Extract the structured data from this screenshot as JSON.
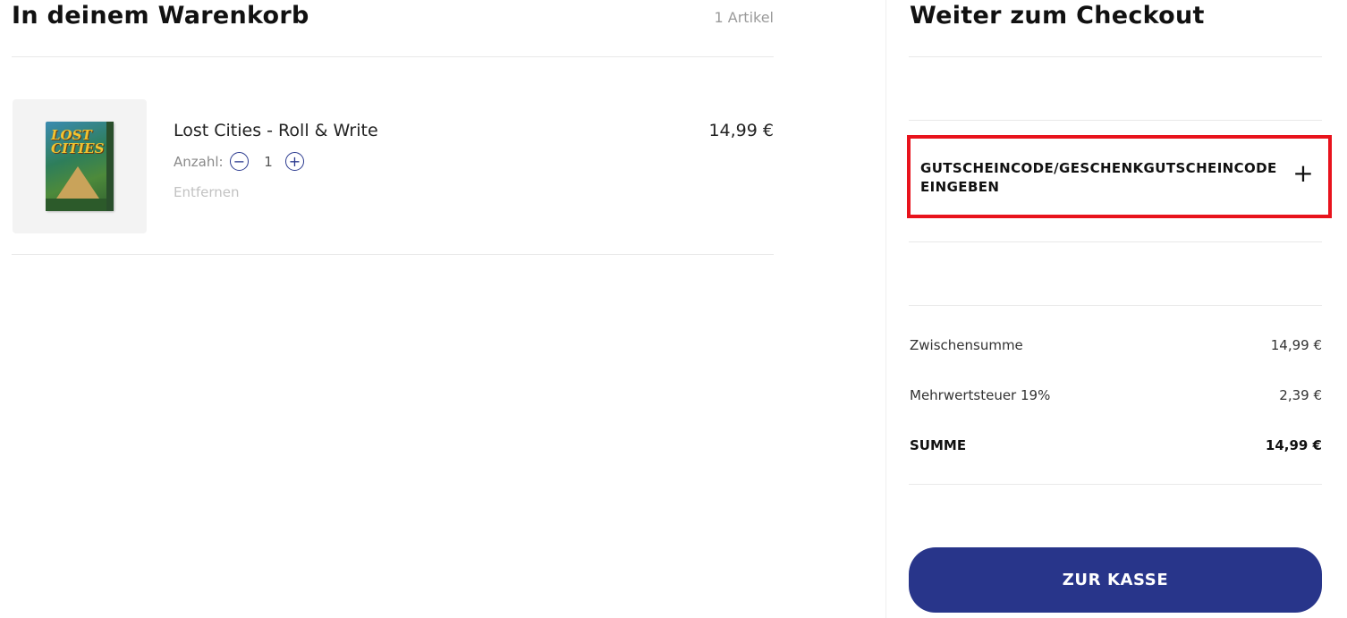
{
  "cart": {
    "title": "In deinem Warenkorb",
    "count": "1 Artikel",
    "items": [
      {
        "name": "Lost Cities - Roll & Write",
        "price": "14,99 €",
        "quantity_label": "Anzahl:",
        "quantity": "1",
        "remove_label": "Entfernen",
        "thumbnail_icon": "game-box-image"
      }
    ]
  },
  "checkout": {
    "title": "Weiter zum Checkout",
    "coupon_label": "GUTSCHEINCODE/GESCHENKGUTSCHEINCODE EINGEBEN",
    "coupon_expand_icon": "plus-icon",
    "summary": {
      "subtotal_label": "Zwischensumme",
      "subtotal_value": "14,99 €",
      "tax_label": "Mehrwertsteuer 19%",
      "tax_value": "2,39 €",
      "total_label": "SUMME",
      "total_value": "14,99 €"
    },
    "button_label": "ZUR KASSE"
  },
  "colors": {
    "accent": "#28358a",
    "highlight": "#e8131c",
    "divider": "#e9e9e9"
  }
}
